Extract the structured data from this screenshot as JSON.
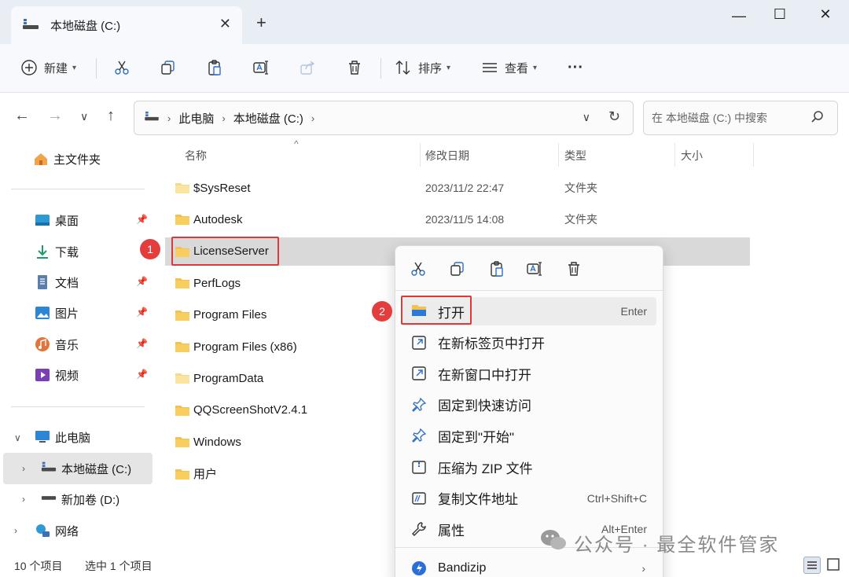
{
  "window": {
    "tab_title": "本地磁盘 (C:)",
    "new_tab": "+",
    "minimize": "—",
    "maximize": "☐",
    "close": "✕"
  },
  "toolbar": {
    "new_label": "新建",
    "sort_label": "排序",
    "view_label": "查看",
    "more_label": "···"
  },
  "address": {
    "crumbs": [
      "此电脑",
      "本地磁盘 (C:)"
    ],
    "search_placeholder": "在 本地磁盘 (C:) 中搜索"
  },
  "sidebar": {
    "home": "主文件夹",
    "quick": [
      {
        "label": "桌面",
        "icon": "desktop-icon"
      },
      {
        "label": "下载",
        "icon": "download-icon"
      },
      {
        "label": "文档",
        "icon": "documents-icon"
      },
      {
        "label": "图片",
        "icon": "pictures-icon"
      },
      {
        "label": "音乐",
        "icon": "music-icon"
      },
      {
        "label": "视频",
        "icon": "videos-icon"
      }
    ],
    "this_pc": "此电脑",
    "drive_c": "本地磁盘 (C:)",
    "drive_d": "新加卷 (D:)",
    "network": "网络"
  },
  "columns": {
    "name": "名称",
    "modified": "修改日期",
    "type": "类型",
    "size": "大小"
  },
  "files": [
    {
      "name": "$SysReset",
      "modified": "2023/11/2 22:47",
      "type": "文件夹"
    },
    {
      "name": "Autodesk",
      "modified": "2023/11/5 14:08",
      "type": "文件夹"
    },
    {
      "name": "LicenseServer",
      "modified": "",
      "type": ""
    },
    {
      "name": "PerfLogs",
      "modified": "",
      "type": ""
    },
    {
      "name": "Program Files",
      "modified": "",
      "type": ""
    },
    {
      "name": "Program Files (x86)",
      "modified": "",
      "type": ""
    },
    {
      "name": "ProgramData",
      "modified": "",
      "type": ""
    },
    {
      "name": "QQScreenShotV2.4.1",
      "modified": "",
      "type": ""
    },
    {
      "name": "Windows",
      "modified": "",
      "type": ""
    },
    {
      "name": "用户",
      "modified": "",
      "type": ""
    }
  ],
  "badges": {
    "one": "1",
    "two": "2"
  },
  "context_menu": {
    "items": [
      {
        "label": "打开",
        "key": "Enter",
        "icon": "folder-open-icon"
      },
      {
        "label": "在新标签页中打开",
        "key": "",
        "icon": "open-new-tab-icon"
      },
      {
        "label": "在新窗口中打开",
        "key": "",
        "icon": "open-new-window-icon"
      },
      {
        "label": "固定到快速访问",
        "key": "",
        "icon": "pin-icon"
      },
      {
        "label": "固定到\"开始\"",
        "key": "",
        "icon": "pin-start-icon"
      },
      {
        "label": "压缩为 ZIP 文件",
        "key": "",
        "icon": "zip-icon"
      },
      {
        "label": "复制文件地址",
        "key": "Ctrl+Shift+C",
        "icon": "copy-path-icon"
      },
      {
        "label": "属性",
        "key": "Alt+Enter",
        "icon": "wrench-icon"
      }
    ],
    "bandizip": "Bandizip"
  },
  "status": {
    "count": "10 个项目",
    "selected": "选中 1 个项目"
  },
  "watermark": "公众号 · 最全软件管家",
  "colors": {
    "accent_red": "#d93a3a",
    "folder_yellow": "#f2c14e",
    "selection_grey": "#d9d9d9"
  }
}
